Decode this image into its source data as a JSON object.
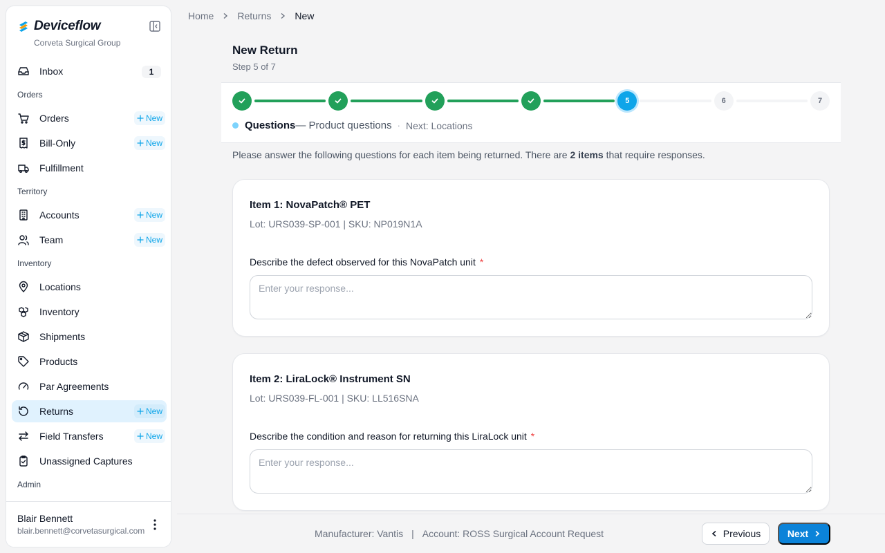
{
  "app": {
    "name": "Deviceflow",
    "org": "Corveta Surgical Group"
  },
  "sidebar": {
    "new_label": "New",
    "items": [
      {
        "type": "item",
        "label": "Inbox",
        "icon": "inbox-icon",
        "count": "1"
      },
      {
        "type": "section",
        "label": "Orders"
      },
      {
        "type": "item",
        "label": "Orders",
        "icon": "cart-icon",
        "has_new": true
      },
      {
        "type": "item",
        "label": "Bill-Only",
        "icon": "receipt-icon",
        "has_new": true
      },
      {
        "type": "item",
        "label": "Fulfillment",
        "icon": "truck-icon"
      },
      {
        "type": "section",
        "label": "Territory"
      },
      {
        "type": "item",
        "label": "Accounts",
        "icon": "building-icon",
        "has_new": true
      },
      {
        "type": "item",
        "label": "Team",
        "icon": "users-icon",
        "has_new": true
      },
      {
        "type": "section",
        "label": "Inventory"
      },
      {
        "type": "item",
        "label": "Locations",
        "icon": "map-pin-icon"
      },
      {
        "type": "item",
        "label": "Inventory",
        "icon": "boxes-icon"
      },
      {
        "type": "item",
        "label": "Shipments",
        "icon": "package-icon"
      },
      {
        "type": "item",
        "label": "Products",
        "icon": "tag-icon"
      },
      {
        "type": "item",
        "label": "Par Agreements",
        "icon": "gauge-icon"
      },
      {
        "type": "item",
        "label": "Returns",
        "icon": "rotate-ccw-icon",
        "has_new": true,
        "active": true
      },
      {
        "type": "item",
        "label": "Field Transfers",
        "icon": "arrows-transfer-icon",
        "has_new": true
      },
      {
        "type": "item",
        "label": "Unassigned Captures",
        "icon": "clipboard-check-icon"
      },
      {
        "type": "section",
        "label": "Admin"
      }
    ],
    "user": {
      "name": "Blair Bennett",
      "email": "blair.bennett@corvetasurgical.com"
    }
  },
  "breadcrumb": [
    "Home",
    "Returns",
    "New"
  ],
  "page": {
    "title": "New Return",
    "step_text": "Step 5 of 7"
  },
  "stepper": {
    "steps": [
      "1",
      "2",
      "3",
      "4",
      "5",
      "6",
      "7"
    ],
    "completed": 4,
    "current": 5,
    "current_name": "Questions",
    "current_desc": "— Product questions",
    "separator": "·",
    "next_text": "Next: Locations"
  },
  "instructions": {
    "before": "Please answer the following questions for each item being returned. There are ",
    "bold": "2 items",
    "after": " that require responses."
  },
  "items": [
    {
      "title": "Item 1: NovaPatch® PET",
      "meta": "Lot: URS039-SP-001 | SKU: NP019N1A",
      "question": "Describe the defect observed for this NovaPatch unit",
      "required_mark": "*",
      "placeholder": "Enter your response...",
      "value": ""
    },
    {
      "title": "Item 2: LiraLock® Instrument SN",
      "meta": "Lot: URS039-FL-001 | SKU: LL516SNA",
      "question": "Describe the condition and reason for returning this LiraLock unit",
      "required_mark": "*",
      "placeholder": "Enter your response...",
      "value": ""
    }
  ],
  "footer": {
    "manufacturer": "Manufacturer: Vantis",
    "divider": "|",
    "account": "Account: ROSS Surgical Account Request",
    "prev_label": "Previous",
    "next_label": "Next"
  },
  "colors": {
    "accent": "#0ea5e9",
    "primary_button": "#0b83d9",
    "success": "#22a05a",
    "required": "#ef4444"
  }
}
